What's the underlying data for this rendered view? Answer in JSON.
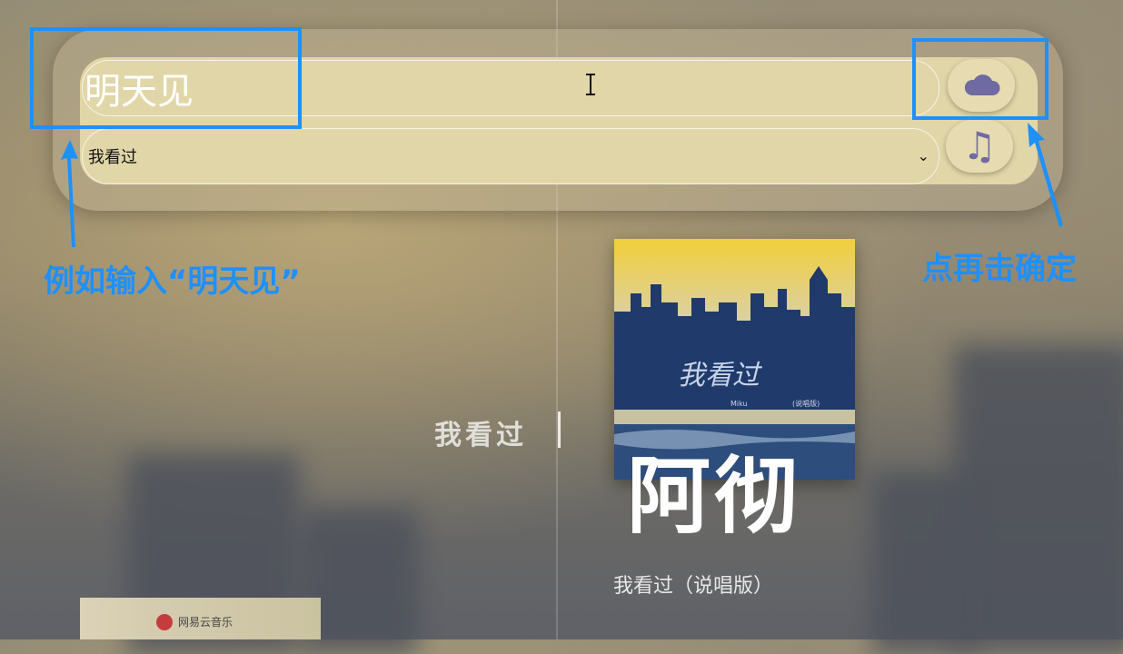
{
  "search": {
    "value": "明天见"
  },
  "playlist_select": {
    "selected": "我看过"
  },
  "buttons": {
    "cloud_icon": "cloud-icon",
    "music_glyph": "♫"
  },
  "annotations": {
    "input_hint": "例如输入“明天见”",
    "click_hint": "点再击确定",
    "color": "#1e90ff"
  },
  "now_playing": {
    "lyric": "我看过",
    "artist": "阿彻",
    "song": "我看过（说唱版）",
    "cover_text": "我看过",
    "cover_small_left": "Miku",
    "cover_small_right": "(说唱版)"
  },
  "thumbnail": {
    "label": "网易云音乐"
  },
  "colors": {
    "accent": "#6f6aa0",
    "bar": "#e1d6a7"
  }
}
